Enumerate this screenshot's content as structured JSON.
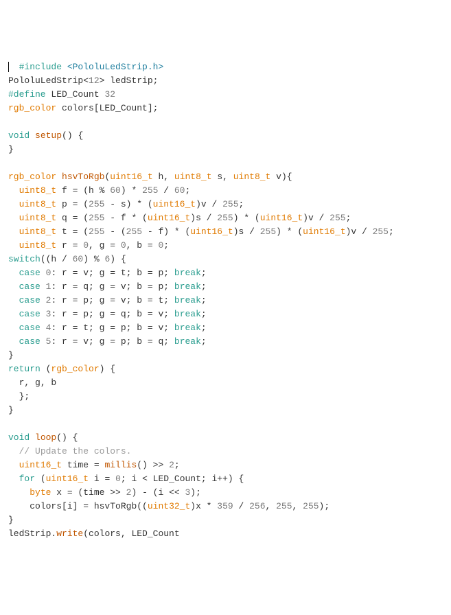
{
  "code": {
    "lines": [
      {
        "cursor": true,
        "indent": 1,
        "tokens": [
          {
            "t": "#include ",
            "c": "c-kw"
          },
          {
            "t": "<PololuLedStrip.h>",
            "c": "c-str"
          }
        ]
      },
      {
        "tokens": [
          {
            "t": "PololuLedStrip",
            "c": "c-def"
          },
          {
            "t": "<",
            "c": "c-def"
          },
          {
            "t": "12",
            "c": "c-num"
          },
          {
            "t": "> ledStrip;",
            "c": "c-def"
          }
        ]
      },
      {
        "tokens": [
          {
            "t": "#define",
            "c": "c-kw"
          },
          {
            "t": " ",
            "c": "c-def"
          },
          {
            "t": "LED_Count",
            "c": "c-var"
          },
          {
            "t": " ",
            "c": "c-def"
          },
          {
            "t": "32",
            "c": "c-num"
          }
        ]
      },
      {
        "tokens": [
          {
            "t": "rgb_color",
            "c": "c-type"
          },
          {
            "t": " colors[LED_Count];",
            "c": "c-def"
          }
        ]
      },
      {
        "blank": true
      },
      {
        "tokens": [
          {
            "t": "void",
            "c": "c-kw"
          },
          {
            "t": " ",
            "c": "c-def"
          },
          {
            "t": "setup",
            "c": "c-fn"
          },
          {
            "t": "() {",
            "c": "c-def"
          }
        ]
      },
      {
        "tokens": [
          {
            "t": "}",
            "c": "c-def"
          }
        ]
      },
      {
        "blank": true
      },
      {
        "tokens": [
          {
            "t": "rgb_color",
            "c": "c-type"
          },
          {
            "t": " ",
            "c": "c-def"
          },
          {
            "t": "hsvToRgb",
            "c": "c-fn"
          },
          {
            "t": "(",
            "c": "c-def"
          },
          {
            "t": "uint16_t",
            "c": "c-type"
          },
          {
            "t": " h, ",
            "c": "c-def"
          },
          {
            "t": "uint8_t",
            "c": "c-type"
          },
          {
            "t": " s, ",
            "c": "c-def"
          },
          {
            "t": "uint8_t",
            "c": "c-type"
          },
          {
            "t": " v){",
            "c": "c-def"
          }
        ]
      },
      {
        "indent": 1,
        "tokens": [
          {
            "t": "uint8_t",
            "c": "c-type"
          },
          {
            "t": " f = (h % ",
            "c": "c-def"
          },
          {
            "t": "60",
            "c": "c-num"
          },
          {
            "t": ") * ",
            "c": "c-def"
          },
          {
            "t": "255",
            "c": "c-num"
          },
          {
            "t": " / ",
            "c": "c-def"
          },
          {
            "t": "60",
            "c": "c-num"
          },
          {
            "t": ";",
            "c": "c-def"
          }
        ]
      },
      {
        "indent": 1,
        "tokens": [
          {
            "t": "uint8_t",
            "c": "c-type"
          },
          {
            "t": " p = (",
            "c": "c-def"
          },
          {
            "t": "255",
            "c": "c-num"
          },
          {
            "t": " - s) * (",
            "c": "c-def"
          },
          {
            "t": "uint16_t",
            "c": "c-type"
          },
          {
            "t": ")v / ",
            "c": "c-def"
          },
          {
            "t": "255",
            "c": "c-num"
          },
          {
            "t": ";",
            "c": "c-def"
          }
        ]
      },
      {
        "indent": 1,
        "tokens": [
          {
            "t": "uint8_t",
            "c": "c-type"
          },
          {
            "t": " q = (",
            "c": "c-def"
          },
          {
            "t": "255",
            "c": "c-num"
          },
          {
            "t": " - f * (",
            "c": "c-def"
          },
          {
            "t": "uint16_t",
            "c": "c-type"
          },
          {
            "t": ")s / ",
            "c": "c-def"
          },
          {
            "t": "255",
            "c": "c-num"
          },
          {
            "t": ") * (",
            "c": "c-def"
          },
          {
            "t": "uint16_t",
            "c": "c-type"
          },
          {
            "t": ")v / ",
            "c": "c-def"
          },
          {
            "t": "255",
            "c": "c-num"
          },
          {
            "t": ";",
            "c": "c-def"
          }
        ]
      },
      {
        "indent": 1,
        "tokens": [
          {
            "t": "uint8_t",
            "c": "c-type"
          },
          {
            "t": " t = (",
            "c": "c-def"
          },
          {
            "t": "255",
            "c": "c-num"
          },
          {
            "t": " - (",
            "c": "c-def"
          },
          {
            "t": "255",
            "c": "c-num"
          },
          {
            "t": " - f) * (",
            "c": "c-def"
          },
          {
            "t": "uint16_t",
            "c": "c-type"
          },
          {
            "t": ")s / ",
            "c": "c-def"
          },
          {
            "t": "255",
            "c": "c-num"
          },
          {
            "t": ") * (",
            "c": "c-def"
          },
          {
            "t": "uint16_t",
            "c": "c-type"
          },
          {
            "t": ")v / ",
            "c": "c-def"
          },
          {
            "t": "255",
            "c": "c-num"
          },
          {
            "t": ";",
            "c": "c-def"
          }
        ]
      },
      {
        "indent": 1,
        "tokens": [
          {
            "t": "uint8_t",
            "c": "c-type"
          },
          {
            "t": " r = ",
            "c": "c-def"
          },
          {
            "t": "0",
            "c": "c-num"
          },
          {
            "t": ", g = ",
            "c": "c-def"
          },
          {
            "t": "0",
            "c": "c-num"
          },
          {
            "t": ", b = ",
            "c": "c-def"
          },
          {
            "t": "0",
            "c": "c-num"
          },
          {
            "t": ";",
            "c": "c-def"
          }
        ]
      },
      {
        "tokens": [
          {
            "t": "switch",
            "c": "c-kw"
          },
          {
            "t": "((h / ",
            "c": "c-def"
          },
          {
            "t": "60",
            "c": "c-num"
          },
          {
            "t": ") % ",
            "c": "c-def"
          },
          {
            "t": "6",
            "c": "c-num"
          },
          {
            "t": ") {",
            "c": "c-def"
          }
        ]
      },
      {
        "indent": 1,
        "tokens": [
          {
            "t": "case",
            "c": "c-kw"
          },
          {
            "t": " ",
            "c": "c-def"
          },
          {
            "t": "0",
            "c": "c-num"
          },
          {
            "t": ": r = v; g = t; b = p; ",
            "c": "c-def"
          },
          {
            "t": "break",
            "c": "c-kw"
          },
          {
            "t": ";",
            "c": "c-def"
          }
        ]
      },
      {
        "indent": 1,
        "tokens": [
          {
            "t": "case",
            "c": "c-kw"
          },
          {
            "t": " ",
            "c": "c-def"
          },
          {
            "t": "1",
            "c": "c-num"
          },
          {
            "t": ": r = q; g = v; b = p; ",
            "c": "c-def"
          },
          {
            "t": "break",
            "c": "c-kw"
          },
          {
            "t": ";",
            "c": "c-def"
          }
        ]
      },
      {
        "indent": 1,
        "tokens": [
          {
            "t": "case",
            "c": "c-kw"
          },
          {
            "t": " ",
            "c": "c-def"
          },
          {
            "t": "2",
            "c": "c-num"
          },
          {
            "t": ": r = p; g = v; b = t; ",
            "c": "c-def"
          },
          {
            "t": "break",
            "c": "c-kw"
          },
          {
            "t": ";",
            "c": "c-def"
          }
        ]
      },
      {
        "indent": 1,
        "tokens": [
          {
            "t": "case",
            "c": "c-kw"
          },
          {
            "t": " ",
            "c": "c-def"
          },
          {
            "t": "3",
            "c": "c-num"
          },
          {
            "t": ": r = p; g = q; b = v; ",
            "c": "c-def"
          },
          {
            "t": "break",
            "c": "c-kw"
          },
          {
            "t": ";",
            "c": "c-def"
          }
        ]
      },
      {
        "indent": 1,
        "tokens": [
          {
            "t": "case",
            "c": "c-kw"
          },
          {
            "t": " ",
            "c": "c-def"
          },
          {
            "t": "4",
            "c": "c-num"
          },
          {
            "t": ": r = t; g = p; b = v; ",
            "c": "c-def"
          },
          {
            "t": "break",
            "c": "c-kw"
          },
          {
            "t": ";",
            "c": "c-def"
          }
        ]
      },
      {
        "indent": 1,
        "tokens": [
          {
            "t": "case",
            "c": "c-kw"
          },
          {
            "t": " ",
            "c": "c-def"
          },
          {
            "t": "5",
            "c": "c-num"
          },
          {
            "t": ": r = v; g = p; b = q; ",
            "c": "c-def"
          },
          {
            "t": "break",
            "c": "c-kw"
          },
          {
            "t": ";",
            "c": "c-def"
          }
        ]
      },
      {
        "tokens": [
          {
            "t": "}",
            "c": "c-def"
          }
        ]
      },
      {
        "tokens": [
          {
            "t": "return",
            "c": "c-kw"
          },
          {
            "t": " (",
            "c": "c-def"
          },
          {
            "t": "rgb_color",
            "c": "c-type"
          },
          {
            "t": ") {",
            "c": "c-def"
          }
        ]
      },
      {
        "indent": 1,
        "tokens": [
          {
            "t": "r, g, b",
            "c": "c-def"
          }
        ]
      },
      {
        "indent": 1,
        "tokens": [
          {
            "t": "};",
            "c": "c-def"
          }
        ]
      },
      {
        "tokens": [
          {
            "t": "}",
            "c": "c-def"
          }
        ]
      },
      {
        "blank": true
      },
      {
        "tokens": [
          {
            "t": "void",
            "c": "c-kw"
          },
          {
            "t": " ",
            "c": "c-def"
          },
          {
            "t": "loop",
            "c": "c-fn"
          },
          {
            "t": "() {",
            "c": "c-def"
          }
        ]
      },
      {
        "indent": 1,
        "tokens": [
          {
            "t": "// Update the colors.",
            "c": "c-cmt"
          }
        ]
      },
      {
        "indent": 1,
        "tokens": [
          {
            "t": "uint16_t",
            "c": "c-type"
          },
          {
            "t": " time = ",
            "c": "c-def"
          },
          {
            "t": "millis",
            "c": "c-fn"
          },
          {
            "t": "() >> ",
            "c": "c-def"
          },
          {
            "t": "2",
            "c": "c-num"
          },
          {
            "t": ";",
            "c": "c-def"
          }
        ]
      },
      {
        "indent": 1,
        "tokens": [
          {
            "t": "for",
            "c": "c-kw"
          },
          {
            "t": " (",
            "c": "c-def"
          },
          {
            "t": "uint16_t",
            "c": "c-type"
          },
          {
            "t": " i = ",
            "c": "c-def"
          },
          {
            "t": "0",
            "c": "c-num"
          },
          {
            "t": "; i < LED_Count; i++) {",
            "c": "c-def"
          }
        ]
      },
      {
        "indent": 2,
        "tokens": [
          {
            "t": "byte",
            "c": "c-type"
          },
          {
            "t": " x = (time >> ",
            "c": "c-def"
          },
          {
            "t": "2",
            "c": "c-num"
          },
          {
            "t": ") - (i << ",
            "c": "c-def"
          },
          {
            "t": "3",
            "c": "c-num"
          },
          {
            "t": ");",
            "c": "c-def"
          }
        ]
      },
      {
        "indent": 2,
        "tokens": [
          {
            "t": "colors[i] = hsvToRgb((",
            "c": "c-def"
          },
          {
            "t": "uint32_t",
            "c": "c-type"
          },
          {
            "t": ")x * ",
            "c": "c-def"
          },
          {
            "t": "359",
            "c": "c-num"
          },
          {
            "t": " / ",
            "c": "c-def"
          },
          {
            "t": "256",
            "c": "c-num"
          },
          {
            "t": ", ",
            "c": "c-def"
          },
          {
            "t": "255",
            "c": "c-num"
          },
          {
            "t": ", ",
            "c": "c-def"
          },
          {
            "t": "255",
            "c": "c-num"
          },
          {
            "t": ");",
            "c": "c-def"
          }
        ]
      },
      {
        "tokens": [
          {
            "t": "}",
            "c": "c-def"
          }
        ]
      },
      {
        "tokens": [
          {
            "t": "ledStrip.",
            "c": "c-def"
          },
          {
            "t": "write",
            "c": "c-fn"
          },
          {
            "t": "(colors, LED_Count",
            "c": "c-def"
          }
        ]
      }
    ]
  },
  "indent_unit": "  "
}
